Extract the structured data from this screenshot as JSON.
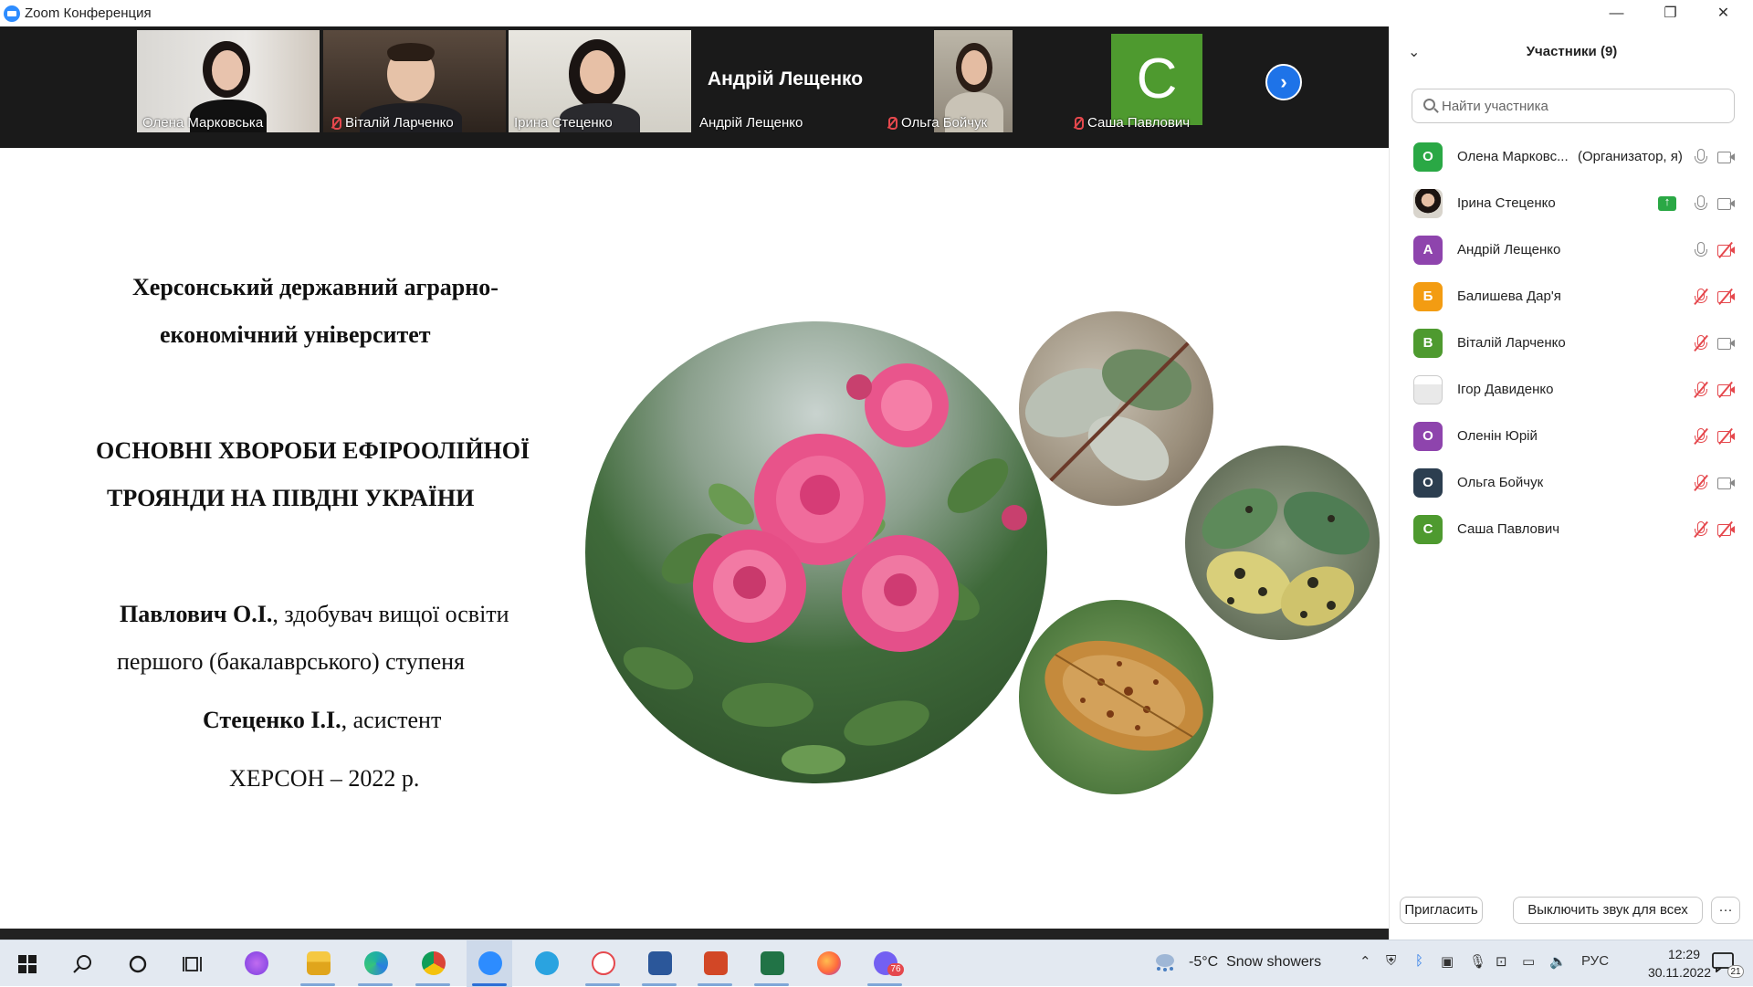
{
  "window": {
    "title": "Zoom Конференция",
    "minimize_glyph": "—",
    "restore_glyph": "❐",
    "close_glyph": "✕"
  },
  "gallery": {
    "tiles": [
      {
        "name": "Олена Марковська",
        "muted": false,
        "video": true
      },
      {
        "name": "Віталій Ларченко",
        "muted": true,
        "video": true
      },
      {
        "name": "Ірина Стеценко",
        "muted": false,
        "video": true,
        "active": true
      },
      {
        "name": "Андрій Лещенко",
        "display_name": "Андрій Лещенко",
        "muted": false,
        "video": false
      },
      {
        "name": "Ольга Бойчук",
        "muted": true,
        "video": true
      },
      {
        "name": "Саша Павлович",
        "muted": true,
        "video": false,
        "avatar_letter": "C"
      }
    ],
    "next_glyph": "›"
  },
  "slide": {
    "university_line1": "Херсонський державний аграрно-",
    "university_line2": "економічний університет",
    "topic_line1": "ОСНОВНІ ХВОРОБИ ЕФІРООЛІЙНОЇ",
    "topic_line2": "ТРОЯНДИ НА ПІВДНІ УКРАЇНИ",
    "author1_name": "Павлович О.І.",
    "author1_role": ", здобувач вищої освіти",
    "author1_role2": "першого (бакалаврського) ступеня",
    "author2_name": "Стеценко І.І.",
    "author2_role": ", асистент",
    "city_year": "ХЕРСОН – 2022 р."
  },
  "participants_panel": {
    "title": "Участники (9)",
    "collapse_glyph": "⌄",
    "search_placeholder": "Найти участника",
    "participants": [
      {
        "name": "Олена Марковс...",
        "role": "(Организатор, я)",
        "avatar": "О",
        "avatar_color": "#2aa845",
        "mic_on": true,
        "cam_on": true
      },
      {
        "name": "Ірина Стеценко",
        "role": "",
        "avatar": "",
        "avatar_color": "#8a6d5a",
        "photo": true,
        "sharing": true,
        "mic_on": true,
        "cam_on": true
      },
      {
        "name": "Андрій Лещенко",
        "role": "",
        "avatar": "А",
        "avatar_color": "#8e44ad",
        "mic_on": true,
        "cam_on": false
      },
      {
        "name": "Балишева Дар'я",
        "role": "",
        "avatar": "Б",
        "avatar_color": "#f39c12",
        "mic_on": false,
        "cam_on": false
      },
      {
        "name": "Віталій Ларченко",
        "role": "",
        "avatar": "В",
        "avatar_color": "#4e9a2f",
        "mic_on": false,
        "cam_on": true
      },
      {
        "name": "Ігор Давиденко",
        "role": "",
        "avatar": "",
        "avatar_color": "#e8e8e8",
        "blank": true,
        "mic_on": false,
        "cam_on": false
      },
      {
        "name": "Оленін Юрій",
        "role": "",
        "avatar": "О",
        "avatar_color": "#8e44ad",
        "mic_on": false,
        "cam_on": false
      },
      {
        "name": "Ольга Бойчук",
        "role": "",
        "avatar": "О",
        "avatar_color": "#2c3e50",
        "mic_on": false,
        "cam_on": true
      },
      {
        "name": "Саша Павлович",
        "role": "",
        "avatar": "С",
        "avatar_color": "#4e9a2f",
        "mic_on": false,
        "cam_on": false
      }
    ],
    "invite_label": "Пригласить",
    "mute_all_label": "Выключить звук для всех",
    "more_label": "···"
  },
  "taskbar": {
    "apps": [
      "windows-start",
      "search",
      "cortana",
      "task-view",
      "alice",
      "file-explorer",
      "edge",
      "chrome",
      "zoom",
      "telegram",
      "yandex-browser",
      "word",
      "powerpoint",
      "excel",
      "firefox",
      "viber"
    ],
    "viber_badge": "76",
    "weather_temp": "-5°C",
    "weather_text": "Snow showers",
    "language": "РУС",
    "time": "12:29",
    "date": "30.11.2022",
    "notifications": "21"
  }
}
